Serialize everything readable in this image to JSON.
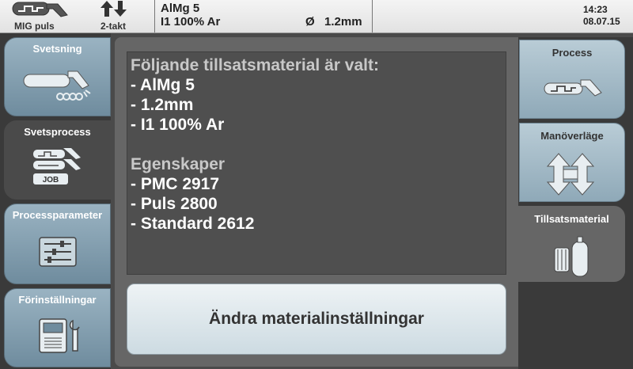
{
  "header": {
    "mode_label": "MIG puls",
    "trigger_label": "2-takt",
    "material": "AlMg 5",
    "gas": "I1 100% Ar",
    "diameter_symbol": "Ø",
    "diameter": "1.2mm",
    "time": "14:23",
    "date": "08.07.15"
  },
  "left_nav": {
    "items": [
      {
        "label": "Svetsning",
        "icon": "welding-torch-icon"
      },
      {
        "label": "Svetsprocess",
        "icon": "job-process-icon",
        "badge": "JOB"
      },
      {
        "label": "Processparameter",
        "icon": "parameter-sliders-icon"
      },
      {
        "label": "Förinställningar",
        "icon": "machine-wrench-icon"
      }
    ]
  },
  "info": {
    "heading1": "Följande tillsatsmaterial är valt:",
    "lines1": [
      "- AlMg 5",
      "- 1.2mm",
      "- I1 100% Ar"
    ],
    "heading2": "Egenskaper",
    "lines2": [
      "- PMC 2917",
      "- Puls 2800",
      "- Standard 2612"
    ]
  },
  "action": {
    "label": "Ändra materialinställningar"
  },
  "right_nav": {
    "items": [
      {
        "label": "Process",
        "icon": "pulse-torch-icon"
      },
      {
        "label": "Manöverläge",
        "icon": "up-down-arrows-icon"
      },
      {
        "label": "Tillsatsmaterial",
        "icon": "wire-gas-cylinder-icon"
      }
    ]
  },
  "colors": {
    "tab_blue": "#8fa9b8",
    "background": "#4a4a4a",
    "panel": "#666666"
  }
}
